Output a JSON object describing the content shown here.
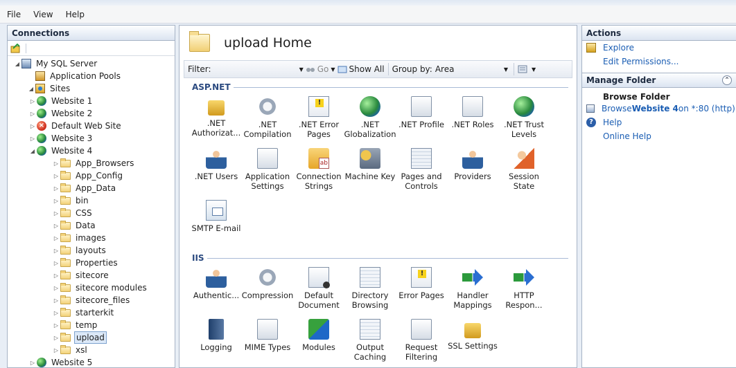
{
  "menu": [
    "File",
    "View",
    "Help"
  ],
  "connections": {
    "title": "Connections",
    "tree": [
      {
        "label": "My SQL Server",
        "icon": "server-icon",
        "level": 0,
        "expander": "expanded"
      },
      {
        "label": "Application Pools",
        "icon": "app-pools-icon",
        "level": 1,
        "expander": "none"
      },
      {
        "label": "Sites",
        "icon": "sites-icon",
        "level": 1,
        "expander": "expanded"
      },
      {
        "label": "Website 1",
        "icon": "globe-icon",
        "level": 2,
        "expander": "collapsed"
      },
      {
        "label": "Website 2",
        "icon": "globe-icon",
        "level": 2,
        "expander": "collapsed"
      },
      {
        "label": "Default Web Site",
        "icon": "stopped-site-icon",
        "level": 2,
        "expander": "collapsed"
      },
      {
        "label": "Website 3",
        "icon": "globe-icon",
        "level": 2,
        "expander": "collapsed"
      },
      {
        "label": "Website 4",
        "icon": "globe-icon",
        "level": 2,
        "expander": "expanded"
      },
      {
        "label": "App_Browsers",
        "icon": "folder-icon",
        "level": 3,
        "expander": "collapsed"
      },
      {
        "label": "App_Config",
        "icon": "folder-icon",
        "level": 3,
        "expander": "collapsed"
      },
      {
        "label": "App_Data",
        "icon": "folder-icon",
        "level": 3,
        "expander": "collapsed"
      },
      {
        "label": "bin",
        "icon": "folder-icon",
        "level": 3,
        "expander": "collapsed"
      },
      {
        "label": "CSS",
        "icon": "folder-icon",
        "level": 3,
        "expander": "collapsed"
      },
      {
        "label": "Data",
        "icon": "folder-icon",
        "level": 3,
        "expander": "collapsed"
      },
      {
        "label": "images",
        "icon": "folder-icon",
        "level": 3,
        "expander": "collapsed"
      },
      {
        "label": "layouts",
        "icon": "folder-icon",
        "level": 3,
        "expander": "collapsed"
      },
      {
        "label": "Properties",
        "icon": "folder-icon",
        "level": 3,
        "expander": "collapsed"
      },
      {
        "label": "sitecore",
        "icon": "folder-icon",
        "level": 3,
        "expander": "collapsed"
      },
      {
        "label": "sitecore modules",
        "icon": "folder-icon",
        "level": 3,
        "expander": "collapsed"
      },
      {
        "label": "sitecore_files",
        "icon": "folder-icon",
        "level": 3,
        "expander": "collapsed"
      },
      {
        "label": "starterkit",
        "icon": "folder-icon",
        "level": 3,
        "expander": "collapsed"
      },
      {
        "label": "temp",
        "icon": "folder-icon",
        "level": 3,
        "expander": "collapsed"
      },
      {
        "label": "upload",
        "icon": "folder-icon",
        "level": 3,
        "expander": "collapsed",
        "selected": true
      },
      {
        "label": "xsl",
        "icon": "folder-icon",
        "level": 3,
        "expander": "collapsed"
      },
      {
        "label": "Website 5",
        "icon": "globe-icon",
        "level": 2,
        "expander": "collapsed"
      }
    ]
  },
  "center": {
    "title": "upload Home",
    "filter_label": "Filter:",
    "go_label": "Go",
    "show_all_label": "Show All",
    "group_by_label": "Group by:",
    "group_by_value": "Area",
    "sections": [
      {
        "title": "ASP.NET",
        "items": [
          {
            "label": ".NET Authorizat...",
            "icon": "authorization-icon",
            "style": "f-lock"
          },
          {
            "label": ".NET Compilation",
            "icon": "compilation-icon",
            "style": "f-gear"
          },
          {
            "label": ".NET Error Pages",
            "icon": "error-pages-icon",
            "style": "f-warn"
          },
          {
            "label": ".NET Globalization",
            "icon": "globalization-icon",
            "style": "f-globe"
          },
          {
            "label": ".NET Profile",
            "icon": "profile-icon",
            "style": "f-doc"
          },
          {
            "label": ".NET Roles",
            "icon": "roles-icon",
            "style": "f-doc"
          },
          {
            "label": ".NET Trust Levels",
            "icon": "trust-levels-icon",
            "style": "f-globe"
          },
          {
            "label": ".NET Users",
            "icon": "users-icon",
            "style": "f-users"
          },
          {
            "label": "Application Settings",
            "icon": "app-settings-icon",
            "style": "f-doc"
          },
          {
            "label": "Connection Strings",
            "icon": "connection-strings-icon",
            "style": "f-strings"
          },
          {
            "label": "Machine Key",
            "icon": "machine-key-icon",
            "style": "f-key"
          },
          {
            "label": "Pages and Controls",
            "icon": "pages-controls-icon",
            "style": "f-pages"
          },
          {
            "label": "Providers",
            "icon": "providers-icon",
            "style": "f-users"
          },
          {
            "label": "Session State",
            "icon": "session-state-icon",
            "style": "f-session"
          },
          {
            "label": "SMTP E-mail",
            "icon": "smtp-icon",
            "style": "f-mail"
          }
        ]
      },
      {
        "title": "IIS",
        "items": [
          {
            "label": "Authentic...",
            "icon": "authentication-icon",
            "style": "f-users"
          },
          {
            "label": "Compression",
            "icon": "compression-icon",
            "style": "f-gear"
          },
          {
            "label": "Default Document",
            "icon": "default-document-icon",
            "style": "f-check"
          },
          {
            "label": "Directory Browsing",
            "icon": "directory-browsing-icon",
            "style": "f-browse"
          },
          {
            "label": "Error Pages",
            "icon": "error-pages-iis-icon",
            "style": "f-warn"
          },
          {
            "label": "Handler Mappings",
            "icon": "handler-mappings-icon",
            "style": "f-arrows"
          },
          {
            "label": "HTTP Respon...",
            "icon": "http-response-icon",
            "style": "f-arrows"
          },
          {
            "label": "Logging",
            "icon": "logging-icon",
            "style": "f-book"
          },
          {
            "label": "MIME Types",
            "icon": "mime-types-icon",
            "style": "f-doc"
          },
          {
            "label": "Modules",
            "icon": "modules-icon",
            "style": "f-puzzle"
          },
          {
            "label": "Output Caching",
            "icon": "output-caching-icon",
            "style": "f-browse"
          },
          {
            "label": "Request Filtering",
            "icon": "request-filtering-icon",
            "style": "f-doc"
          },
          {
            "label": "SSL Settings",
            "icon": "ssl-settings-icon",
            "style": "f-lock"
          }
        ]
      }
    ]
  },
  "actions": {
    "title": "Actions",
    "explore": "Explore",
    "edit_permissions": "Edit Permissions...",
    "manage_folder_title": "Manage Folder",
    "browse_folder_title": "Browse Folder",
    "browse_prefix": "Browse ",
    "browse_site": "Website 4",
    "browse_suffix": " on *:80 (http)",
    "help": "Help",
    "online_help": "Online Help"
  }
}
